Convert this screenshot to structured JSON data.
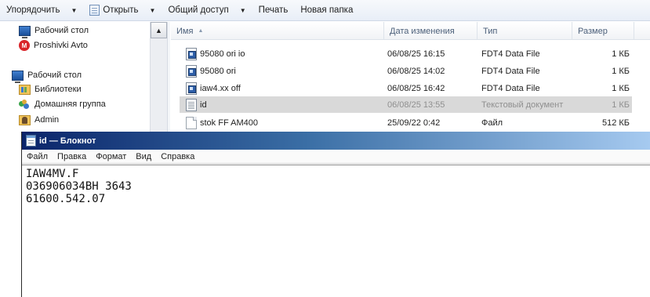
{
  "toolbar": {
    "organize": "Упорядочить",
    "open": "Открыть",
    "share": "Общий доступ",
    "print": "Печать",
    "new_folder": "Новая папка"
  },
  "nav": {
    "items": [
      {
        "label": "Рабочий стол",
        "icon": "desktop-icon"
      },
      {
        "label": "Proshivki Avto",
        "icon": "mega-icon"
      },
      {
        "label": "Рабочий стол",
        "icon": "desktop-icon"
      },
      {
        "label": "Библиотеки",
        "icon": "library-icon"
      },
      {
        "label": "Домашняя группа",
        "icon": "homegroup-icon"
      },
      {
        "label": "Admin",
        "icon": "user-folder-icon"
      }
    ]
  },
  "filelist": {
    "columns": {
      "name": "Имя",
      "date": "Дата изменения",
      "type": "Тип",
      "size": "Размер"
    },
    "rows": [
      {
        "name": "95080 ori io",
        "date": "06/08/25 16:15",
        "type": "FDT4 Data File",
        "size": "1 КБ",
        "icon": "fdt-file-icon"
      },
      {
        "name": "95080 ori",
        "date": "06/08/25 14:02",
        "type": "FDT4 Data File",
        "size": "1 КБ",
        "icon": "fdt-file-icon"
      },
      {
        "name": "iaw4.xx off",
        "date": "06/08/25 16:42",
        "type": "FDT4 Data File",
        "size": "1 КБ",
        "icon": "fdt-file-icon"
      },
      {
        "name": "id",
        "date": "06/08/25 13:55",
        "type": "Текстовый документ",
        "size": "1 КБ",
        "icon": "text-file-icon",
        "selected": true
      },
      {
        "name": "stok FF AM400",
        "date": "25/09/22 0:42",
        "type": "Файл",
        "size": "512 КБ",
        "icon": "file-icon"
      }
    ]
  },
  "notepad": {
    "title": "id — Блокнот",
    "menu": [
      "Файл",
      "Правка",
      "Формат",
      "Вид",
      "Справка"
    ],
    "lines": [
      "IAW4MV.F",
      "036906034BH 3643",
      "61600.542.07"
    ]
  },
  "colors": {
    "titlebar_start": "#0a246a",
    "titlebar_end": "#a6caf0",
    "selection": "#d9d9d9",
    "header_text": "#4c607a"
  }
}
